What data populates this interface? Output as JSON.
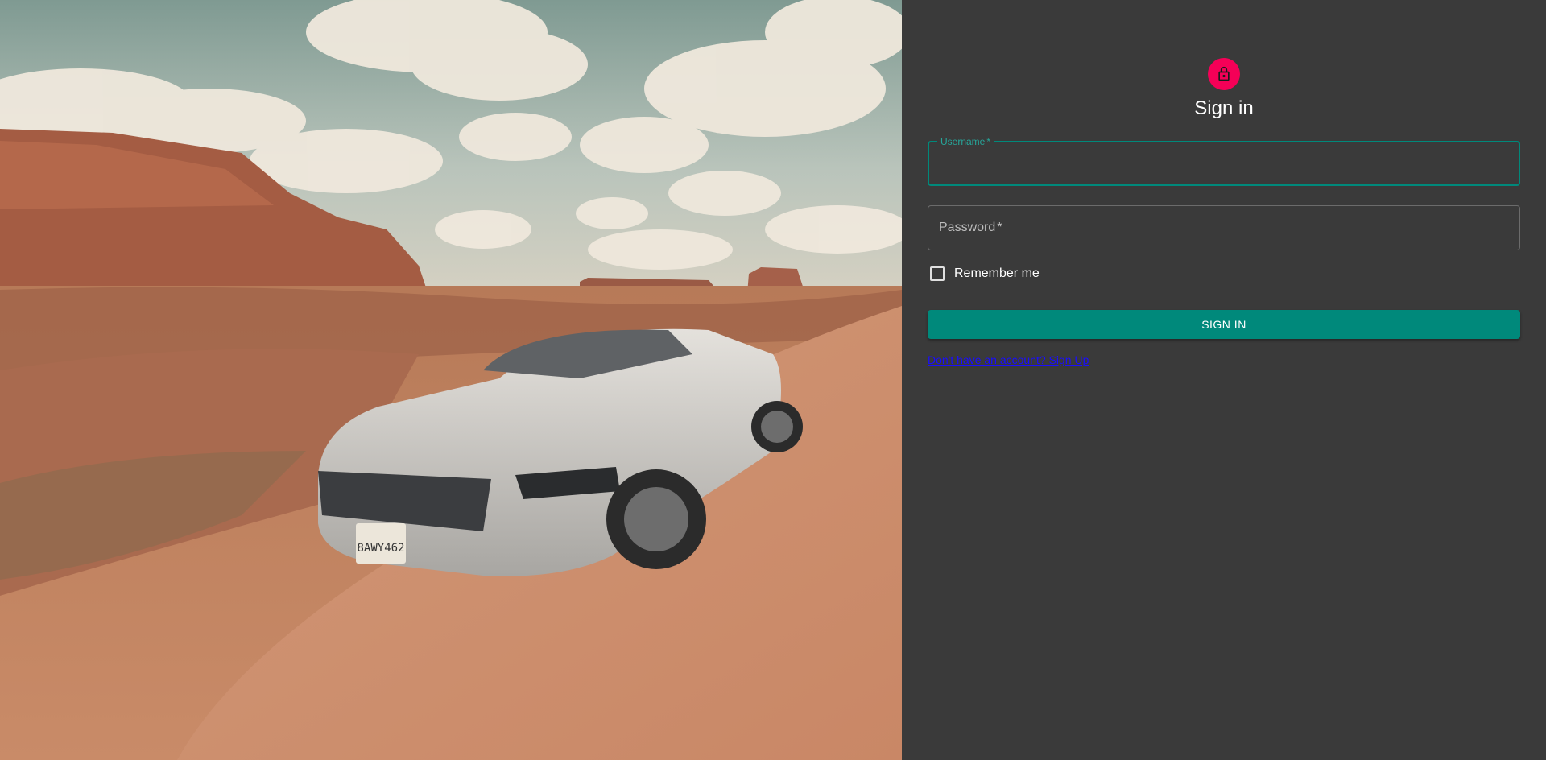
{
  "hero_image": {
    "alt_semantic": "desert-road-convertible-photo",
    "plate_text": "8AWY462"
  },
  "form": {
    "title": "Sign in",
    "username": {
      "label": "Username",
      "required_mark": "*",
      "value": ""
    },
    "password": {
      "label": "Password",
      "required_mark": "*",
      "value": ""
    },
    "remember_label": "Remember me",
    "remember_checked": false,
    "submit_label": "SIGN IN",
    "signup_link": "Don't have an account? Sign Up"
  },
  "icons": {
    "avatar": "lock-icon"
  },
  "colors": {
    "panel_bg": "#3a3a3a",
    "accent": "#00897b",
    "avatar_bg": "#f50057",
    "link": "#1a0dff"
  }
}
